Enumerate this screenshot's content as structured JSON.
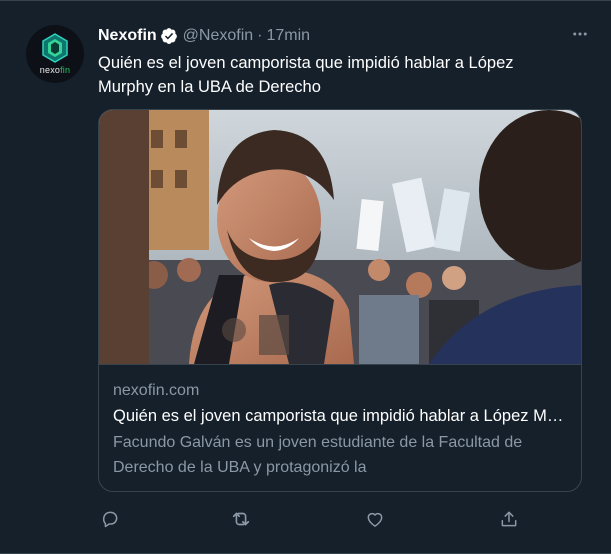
{
  "author": {
    "name": "Nexofin",
    "handle": "@Nexofin",
    "separator": "·",
    "time": "17min",
    "avatar_wordmark": "nexofin",
    "verified": true
  },
  "tweet": {
    "text": "Quién es el joven camporista que impidió hablar a López Murphy en la UBA de Derecho"
  },
  "card": {
    "domain": "nexofin.com",
    "title": "Quién es el joven camporista que impidió hablar a López Murphy en la UBA de Derecho",
    "description": "Facundo Galván es un joven estudiante de la Facultad de Derecho de la UBA y protagonizó la"
  },
  "actions": [
    {
      "icon": "reply-icon"
    },
    {
      "icon": "retweet-icon"
    },
    {
      "icon": "like-icon"
    },
    {
      "icon": "share-icon"
    }
  ],
  "colors": {
    "background": "#15202b",
    "border": "#38444d",
    "secondary_text": "#8b98a5",
    "verified_blue": "#1d9bf0",
    "avatar_accent": "#22c55e"
  }
}
